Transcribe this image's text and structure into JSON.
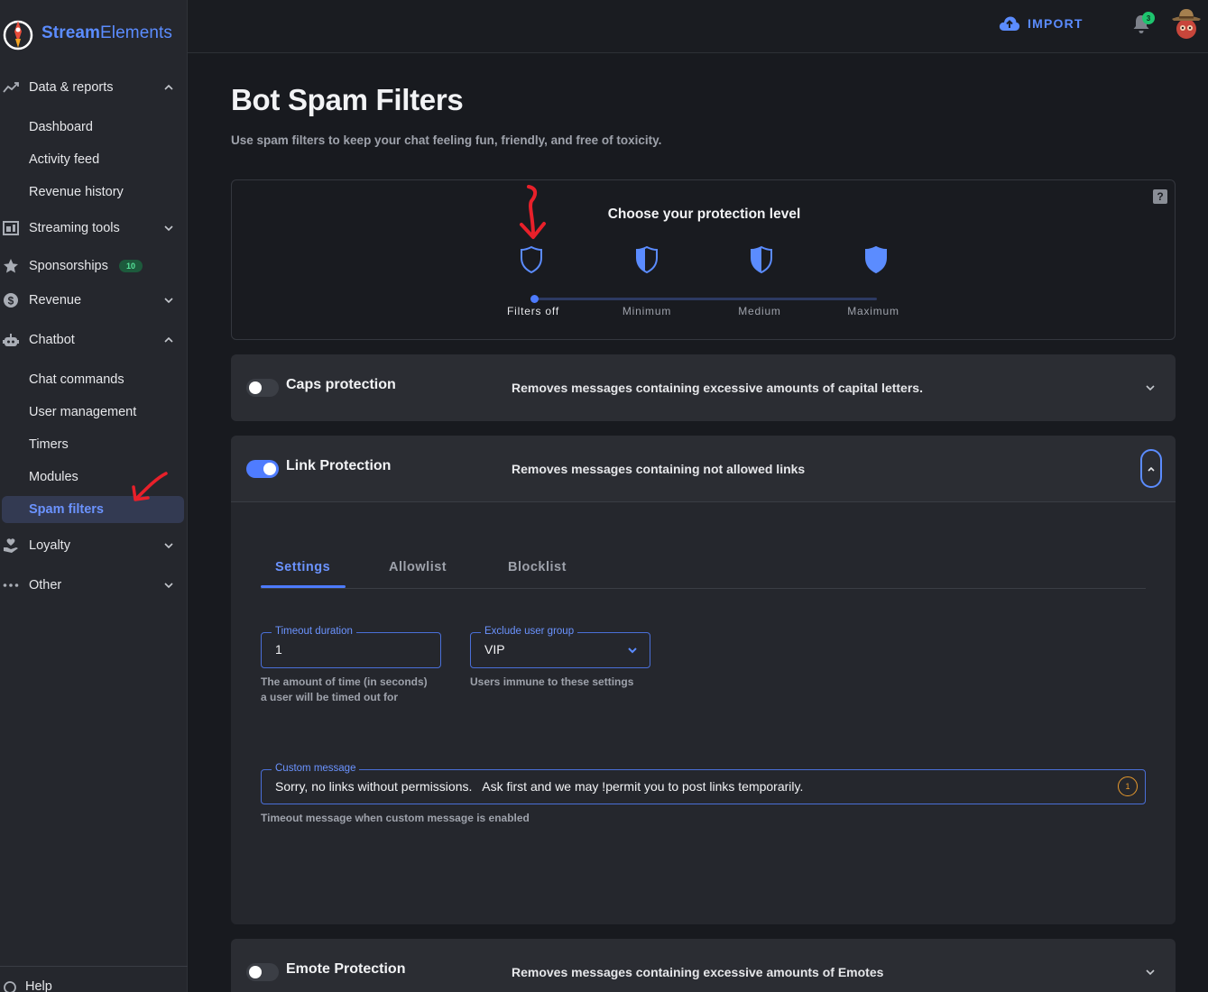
{
  "brand": {
    "bold": "Stream",
    "light": "Elements"
  },
  "sidebar": {
    "items": [
      {
        "label": "Data & reports",
        "icon": "chart-line-icon",
        "chevron": "up"
      },
      {
        "label": "Dashboard"
      },
      {
        "label": "Activity feed"
      },
      {
        "label": "Revenue history"
      },
      {
        "label": "Streaming tools",
        "icon": "streaming-tools-icon",
        "chevron": "down"
      },
      {
        "label": "Sponsorships",
        "icon": "star-icon",
        "badge": "10"
      },
      {
        "label": "Revenue",
        "icon": "dollar-icon",
        "chevron": "down"
      },
      {
        "label": "Chatbot",
        "icon": "robot-icon",
        "chevron": "up"
      },
      {
        "label": "Chat commands"
      },
      {
        "label": "User management"
      },
      {
        "label": "Timers"
      },
      {
        "label": "Modules"
      },
      {
        "label": "Spam filters",
        "active": true
      },
      {
        "label": "Loyalty",
        "icon": "loyalty-icon",
        "chevron": "down"
      },
      {
        "label": "Other",
        "icon": "more-dots-icon",
        "chevron": "down"
      }
    ],
    "footer": {
      "help": "Help"
    }
  },
  "topbar": {
    "import_label": "IMPORT",
    "notifications_count": "3"
  },
  "page": {
    "title": "Bot Spam Filters",
    "subtitle": "Use spam filters to keep your chat feeling fun, friendly, and free of toxicity."
  },
  "protection": {
    "title": "Choose your protection level",
    "help": "?",
    "levels": [
      "Filters off",
      "Minimum",
      "Medium",
      "Maximum"
    ],
    "selected_index": 0
  },
  "filters": {
    "caps": {
      "title": "Caps protection",
      "desc": "Removes messages containing excessive amounts of capital letters.",
      "enabled": false
    },
    "link": {
      "title": "Link Protection",
      "desc": "Removes messages containing not allowed links",
      "enabled": true,
      "tabs": [
        "Settings",
        "Allowlist",
        "Blocklist"
      ],
      "timeout": {
        "label": "Timeout duration",
        "value": "1",
        "helper_1": "The amount of time (in seconds)",
        "helper_2": "a user will be timed out for"
      },
      "exclude": {
        "label": "Exclude user group",
        "value": "VIP",
        "helper": "Users immune to these settings"
      },
      "custom": {
        "label": "Custom message",
        "value": "Sorry, no links without permissions.   Ask first and we may !permit you to post links temporarily.",
        "counter": "1",
        "helper": "Timeout message when custom message is enabled"
      }
    },
    "emote": {
      "title": "Emote Protection",
      "desc": "Removes messages containing excessive amounts of Emotes",
      "enabled": false
    }
  },
  "colors": {
    "accent": "#4f7cff",
    "annotation": "#e8202a",
    "badge": "#1ec46e"
  }
}
